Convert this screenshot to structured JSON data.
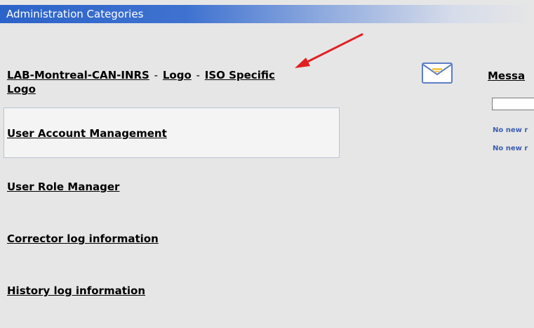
{
  "header": {
    "title": "Administration Categories"
  },
  "breadcrumb": {
    "lab": "LAB-Montreal-CAN-INRS",
    "sep1": "-",
    "logo": "Logo",
    "sep2": "-",
    "iso": "ISO Specific Logo"
  },
  "menu": {
    "items": [
      {
        "label": "User Account Management"
      },
      {
        "label": "User Role Manager"
      },
      {
        "label": "Corrector log information"
      },
      {
        "label": "History log information"
      }
    ]
  },
  "messages": {
    "title": "Messa",
    "input_value": "",
    "notes": [
      "No new r",
      "No new r"
    ],
    "icon": "envelope-icon"
  },
  "colors": {
    "header_blue": "#2c63c9",
    "arrow_red": "#e02020",
    "note_blue": "#3b5fb0",
    "background": "#e6e6e6"
  }
}
